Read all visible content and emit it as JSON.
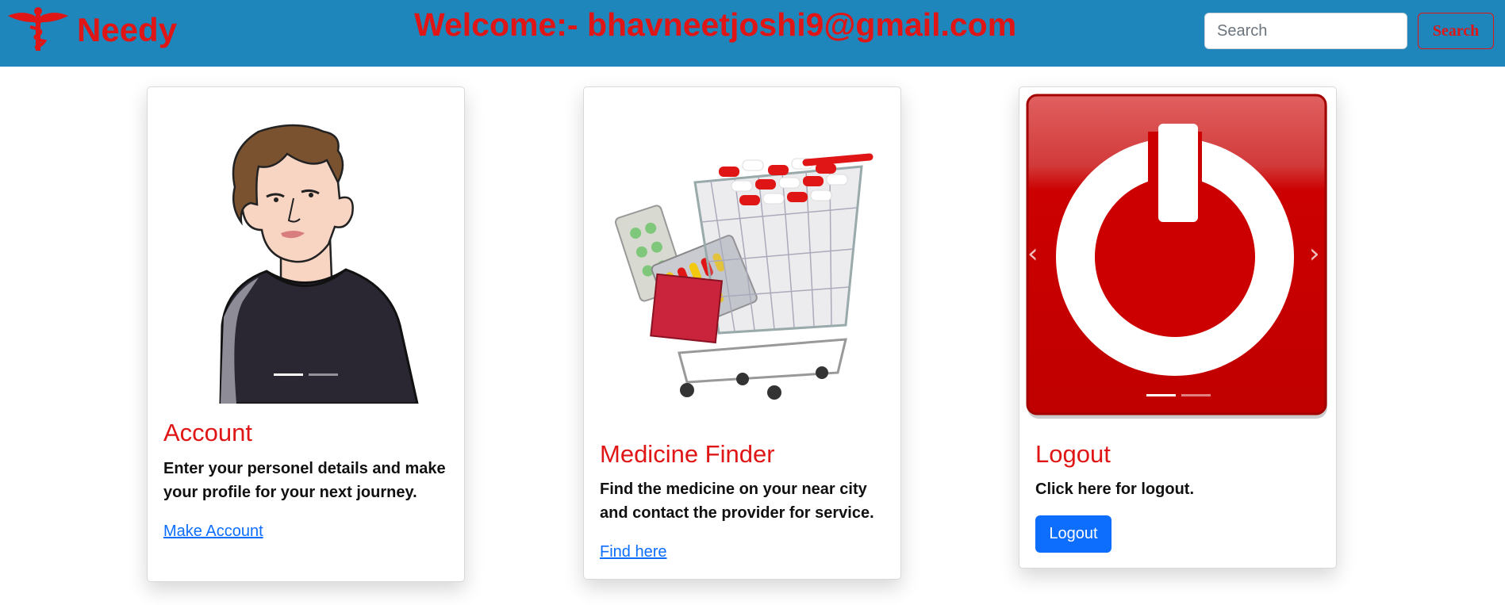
{
  "navbar": {
    "brand": "Needy",
    "welcome": "Welcome:- bhavneetjoshi9@gmail.com",
    "search_placeholder": "Search",
    "search_button": "Search"
  },
  "cards": [
    {
      "title": "Account",
      "text": "Enter your personel details and make your profile for your next journey.",
      "link": "Make Account",
      "image": "person-illustration"
    },
    {
      "title": "Medicine Finder",
      "text": "Find the medicine on your near city and contact the provider for service.",
      "link": "Find here",
      "image": "medicine-cart"
    },
    {
      "title": "Logout",
      "text": "Click here for logout.",
      "button": "Logout",
      "image": "power-button"
    }
  ],
  "colors": {
    "navbar_bg": "#1e86bb",
    "accent_red": "#e01515",
    "link_blue": "#0d6efd"
  },
  "carousel": {
    "prev_icon": "chevron-left-icon",
    "next_icon": "chevron-right-icon",
    "indicator_count": 2,
    "active_indicator": 1
  }
}
